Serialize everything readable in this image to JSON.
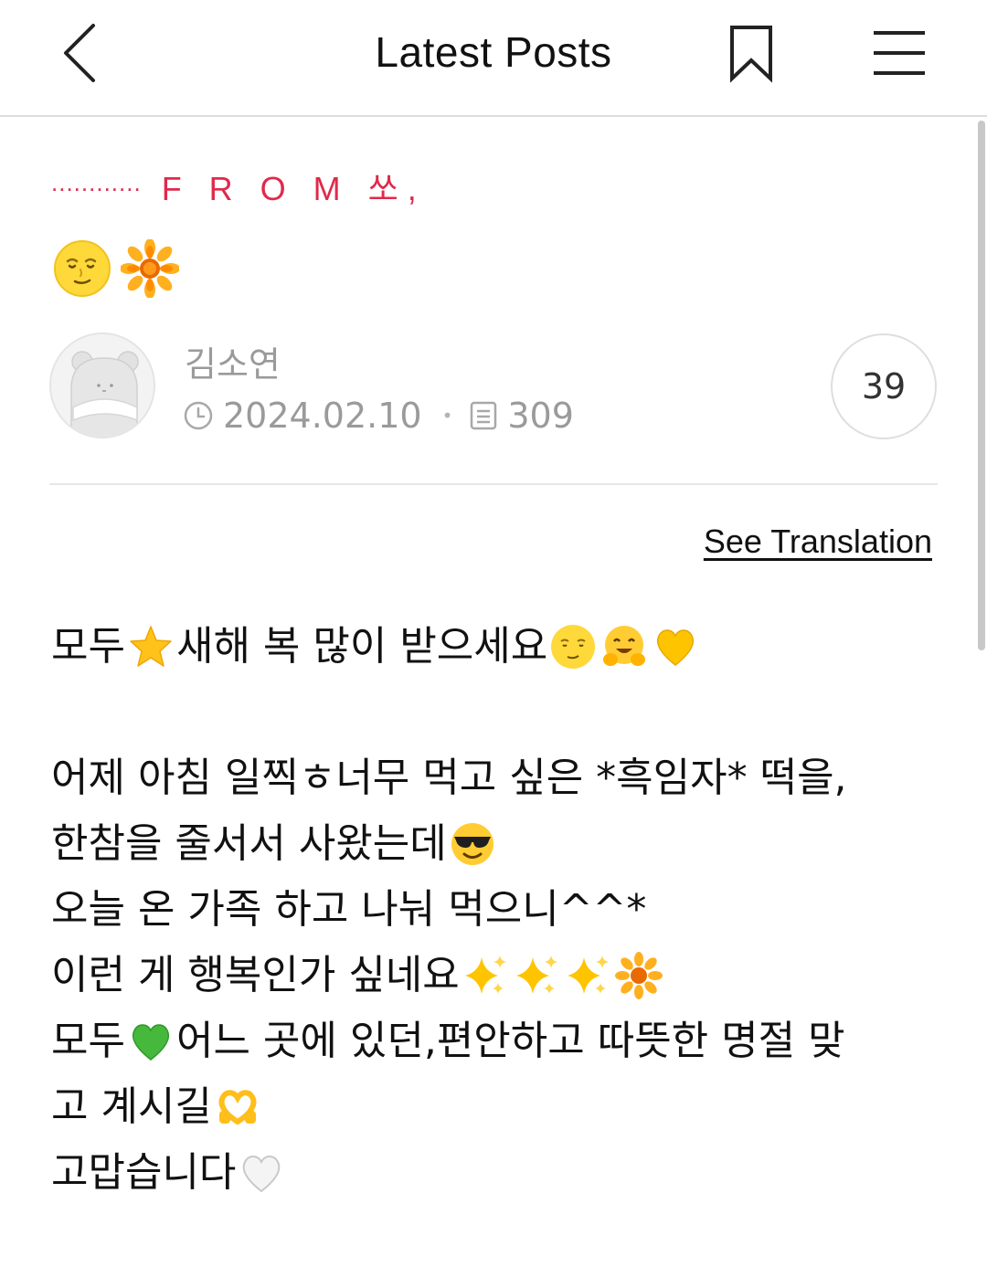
{
  "header": {
    "title": "Latest Posts",
    "icons": [
      "back-chevron-icon",
      "bookmark-icon",
      "hamburger-menu-icon"
    ]
  },
  "board": {
    "dots": "............",
    "name": "F R O M 쏘,"
  },
  "post": {
    "title_emojis": [
      "moon-face-emoji",
      "sunflower-emoji"
    ],
    "author": "김소연",
    "date": "2024.02.10",
    "views": "309",
    "comment_count": "39",
    "see_translation": "See Translation",
    "body": {
      "line1": {
        "a": "모두",
        "b": " 새해 복 많이 받으세요"
      },
      "line2": {
        "a": "어제 아침 일찍ㅎ너무 먹고 싶은 *흑임자* 떡을,"
      },
      "line3": {
        "a": "한참을 줄서서 사왔는데"
      },
      "line4": {
        "a": "오늘 온 가족 하고 나눠 먹으니^^*"
      },
      "line5": {
        "a": "이런 게 행복인가 싶네요"
      },
      "line6": {
        "a": "모두",
        "b": "어느 곳에 있던,편안하고 따뜻한 명절 맞"
      },
      "line7": {
        "a": "고 계시길"
      },
      "line8": {
        "a": "고맙습니다"
      }
    }
  },
  "colors": {
    "accent": "#e0294b",
    "meta_gray": "#9a9a9a",
    "divider": "#e6e6e6"
  }
}
